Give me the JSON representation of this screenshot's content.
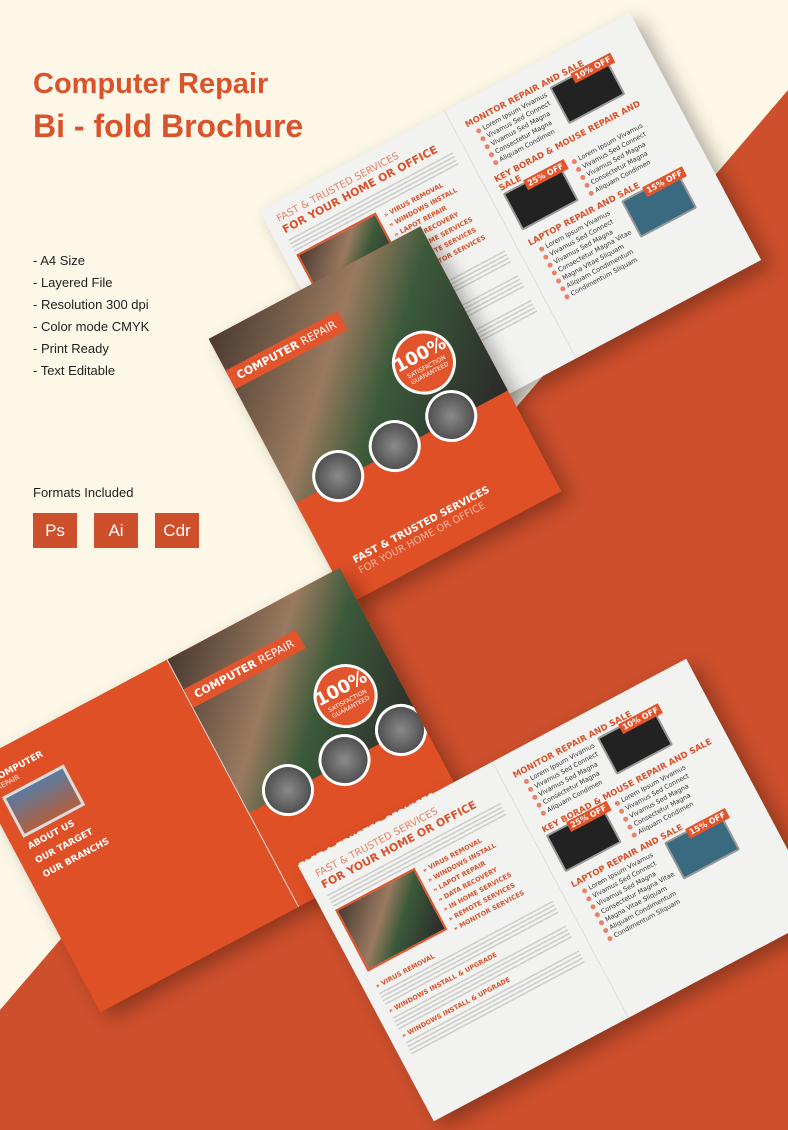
{
  "title_line1": "Computer Repair",
  "title_line2": "Bi - fold Brochure",
  "features": [
    "- A4 Size",
    "- Layered File",
    "- Resolution 300 dpi",
    "- Color mode CMYK",
    "- Print Ready",
    "- Text Editable"
  ],
  "formats_label": "Formats Included",
  "formats": [
    "Ps",
    "Ai",
    "Cdr"
  ],
  "colors": {
    "background": "#fdf7e7",
    "accent": "#cd4f2c"
  },
  "brochure": {
    "inner_left": {
      "heading_light": "FAST & TRUSTED SERVICES",
      "heading_bold": "FOR YOUR HOME OR OFFICE",
      "services": [
        "VIRUS REMOVAL",
        "WINDOWS INSTALL",
        "LAPOT REPAIR",
        "DATA RECOVERY",
        "IN HOME SERVICES",
        "REMOTE SERVICES",
        "MONITOR SERVICES"
      ],
      "sections": [
        "VIRUS REMOVAL",
        "WINDOWS INSTALL & UPGRADE",
        "WINDOWS INSTALL & UPGRADE"
      ]
    },
    "products": [
      {
        "title": "MONITOR REPAIR AND SALE",
        "discount": "10% OFF",
        "bullets": [
          "Lorem Ipsum Vivamus",
          "Vivamus Sed Connect",
          "Vivamus Sed Magna",
          "Consectetur Magna",
          "Aliquam Condimen"
        ]
      },
      {
        "title": "KEY BORAD & MOUSE REPAIR AND SALE",
        "discount": "25% OFF",
        "bullets": [
          "Lorem Ipsum Vivamus",
          "Vivamus Sed Connect",
          "Vivamus Sed Magna",
          "Consectetur Magna",
          "Aliquam Condimen"
        ]
      },
      {
        "title": "LAPTOP REPAIR AND SALE",
        "discount": "15% OFF",
        "bullets": [
          "Lorem Ipsum Vivamus",
          "Vivamus Sed Connect",
          "Vivamus Sed Magna",
          "Consectetur Magna Vitae",
          "Magna Vitae Sliquam",
          "Aliquam Condimentum",
          "Condimentum Sliquam"
        ]
      }
    ],
    "cover": {
      "banner_bold": "COMPUTER",
      "banner_light": " REPAIR",
      "badge_big": "100%",
      "badge_line1": "SATISFACTION",
      "badge_line2": "GUARANTEED",
      "tagline1": "FAST & TRUSTED SERVICES",
      "tagline2": "FOR YOUR HOME OR OFFICE"
    },
    "back": {
      "brand1": "COMPUTER",
      "brand2": "REPAIR",
      "about": "ABOUT US",
      "target": "OUR TARGET",
      "branchs": "OUR BRANCHS"
    }
  }
}
